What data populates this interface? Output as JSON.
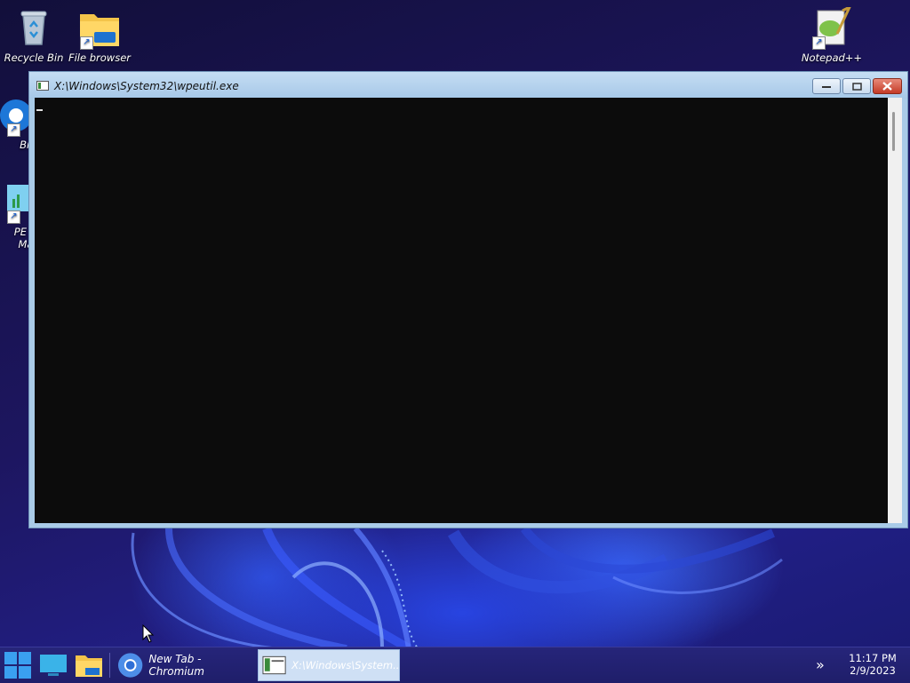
{
  "desktop": {
    "icons": [
      {
        "label": "Recycle Bin"
      },
      {
        "label": "File browser"
      },
      {
        "label": "Notepad++"
      },
      {
        "label": "Bro"
      },
      {
        "label": "PE N"
      },
      {
        "label": "Ma"
      }
    ]
  },
  "window": {
    "title": "X:\\Windows\\System32\\wpeutil.exe",
    "buttons": {
      "minimize": "minimize-icon",
      "maximize": "maximize-icon",
      "close": "close-icon"
    }
  },
  "taskbar": {
    "tasks": [
      {
        "label": "New Tab - Chromium"
      },
      {
        "label": "X:\\Windows\\System..."
      }
    ],
    "clock": {
      "time": "11:17 PM",
      "date": "2/9/2023"
    }
  }
}
